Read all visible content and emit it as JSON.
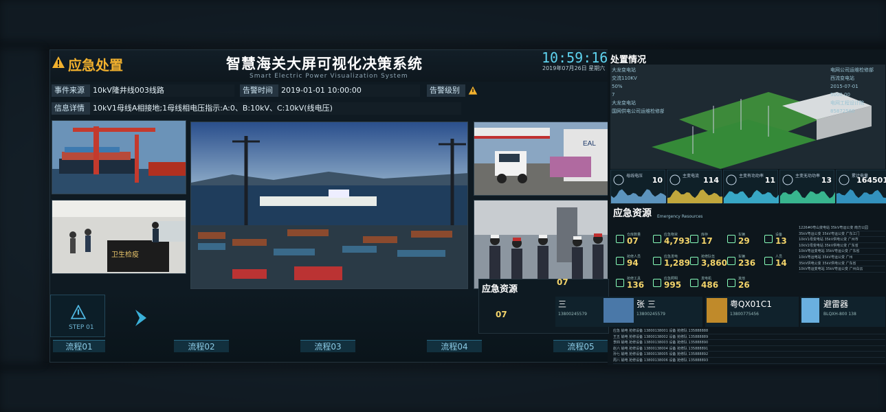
{
  "header": {
    "section_title": "应急处置",
    "system_title": "智慧海关大屏可视化决策系统",
    "system_subtitle": "Smart Electric Power Visualization System"
  },
  "event": {
    "source_label": "事件来源",
    "source_value": "10kV隆井线003线路",
    "time_label": "告警时间",
    "time_value": "2019-01-01  10:00:00",
    "level_label": "告警级别",
    "detail_label": "信息详情",
    "detail_value": "10kV1母线A相接地;1母线相电压指示:A:0、B:10kV、C:10kV(线电压)"
  },
  "photos": [
    "container-ship-crane",
    "customs-checkpoint",
    "port-aerial",
    "cargo-airport",
    "inspection-team",
    "plant-inspection"
  ],
  "checkpoint_sign": "卫生检疫",
  "flow": {
    "step_label": "STEP 01",
    "steps": [
      "流程01",
      "流程02",
      "流程03",
      "流程04",
      "流程05"
    ]
  },
  "clock": {
    "time": "10:59:16",
    "date": "2019年07月26日  星期六"
  },
  "right": {
    "title_disposal": "处置情况",
    "title_resources": "应急资源",
    "title_resources_sub": "Emergency Resources",
    "overlay_title_resources": "应急资源",
    "side_labels": [
      "大龙变电站",
      "交流110KV",
      "50%",
      "7",
      "大龙变电站",
      "国网供电公司运维检修部"
    ],
    "side_labels_right": [
      "电网公司运维检修部",
      "西流变电站",
      "2015-07-01",
      "5000.00",
      "电网工程设计院",
      "85872560"
    ],
    "metrics": [
      {
        "name": "母线电压",
        "value": "10",
        "color": "#6aa9d8"
      },
      {
        "name": "主变电流",
        "value": "114",
        "color": "#e0c040"
      },
      {
        "name": "主变有功功率",
        "value": "11",
        "color": "#40c0e0"
      },
      {
        "name": "主变无功功率",
        "value": "13",
        "color": "#40d0a0"
      },
      {
        "name": "累计电量",
        "value": "164501",
        "color": "#3aa7d8"
      }
    ],
    "resources": [
      {
        "label": "仓库数量",
        "value": "07"
      },
      {
        "label": "应急物资",
        "value": "4,793"
      },
      {
        "label": "库存",
        "value": "17"
      },
      {
        "label": "车辆",
        "value": "29"
      },
      {
        "label": "设备",
        "value": "13"
      },
      {
        "label": "抢修人员",
        "value": "94"
      },
      {
        "label": "应急发电",
        "value": "1,289"
      },
      {
        "label": "抢修队伍",
        "value": "3,860"
      },
      {
        "label": "车辆",
        "value": "236"
      },
      {
        "label": "人员",
        "value": "14"
      },
      {
        "label": "抢修工具",
        "value": "136"
      },
      {
        "label": "应急照明",
        "value": "995"
      },
      {
        "label": "发电机",
        "value": "486"
      },
      {
        "label": "其他",
        "value": "26"
      }
    ],
    "overlay_values": [
      "07",
      "07"
    ],
    "cards": [
      {
        "name": "张 三",
        "sub": "13800245579"
      },
      {
        "name": "粤QX01C1",
        "sub": "13800775456"
      },
      {
        "name": "避雷器",
        "sub": "BLQXH-800  138"
      }
    ],
    "card_left_name": "三",
    "card_left_sub": "13800245579",
    "table_rows": [
      "1226#0粤山变电站  35kV粤运公变  南方公园",
      "35kV粤运公变  35kV粤运公变  广东江门",
      "10kV1母变电站  35kV供电公变  广州市",
      "10kV2母变电站  35kV供电公变  广东省",
      "10kV粤运变电站  35kV粤运公变  广东省",
      "10kV粤运电站  35kV粤运公变  广州",
      "35kV供电公变  35kV供电公变  广东省",
      "10kV粤运变电站  35kV粤运公变  广州白云"
    ],
    "bottom_rows": [
      "应急  输电  抢修设备  13800138001  设备  抢修队  135888888",
      "王五  输电  抢修设备  13800138002  设备  抢修队  135888889",
      "李四  输电  抢修设备  13800138003  设备  抢修队  135888890",
      "赵六  输电  抢修设备  13800138004  设备  抢修队  135888891",
      "孙七  输电  抢修设备  13800138005  设备  抢修队  135888892",
      "周八  输电  抢修设备  13800138006  设备  抢修队  135888893"
    ]
  },
  "colors": {
    "accent": "#f2b12e",
    "cyan": "#5fd4f0",
    "panel": "#0f1a22"
  }
}
